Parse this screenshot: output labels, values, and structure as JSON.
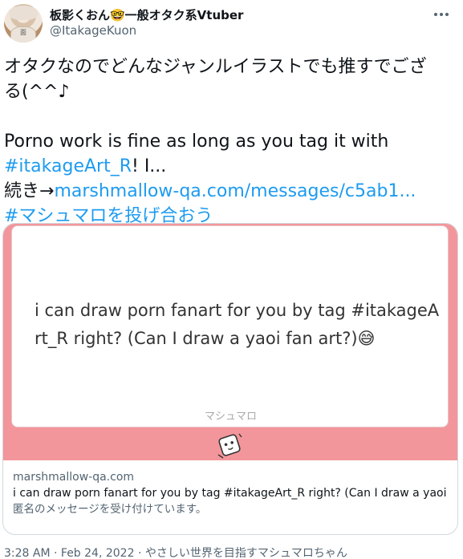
{
  "author": {
    "display_name": "板影くおん🤓一般オタク系Vtuber",
    "handle": "@ItakageKuon",
    "avatar_mark": "面"
  },
  "more_icon": "ellipsis-icon",
  "tweet": {
    "line1": "オタクなのでどんなジャンルイラストでも推すでござ",
    "line2": "る(^^♪",
    "line3": "Porno work is fine as long as you tag it with",
    "hashtag1": "#itakageArt_R",
    "line4_rest": "! I...",
    "continue_label": "続き→",
    "continue_link": "marshmallow-qa.com/messages/c5ab1...",
    "hashtag2": "#マシュマロを投げ合おう"
  },
  "card": {
    "question_line1": "i can draw porn fanart for you by tag #itakageA",
    "question_line2": "rt_R right? (Can I draw a yaoi fan art?)😅",
    "brand": "マシュマロ",
    "mascot_icon": "marshmallow-mascot-icon",
    "domain": "marshmallow-qa.com",
    "title": "i can draw porn fanart for you by tag #itakageArt_R right? (Can I draw a yaoi fa...",
    "description": "匿名のメッセージを受け付けています。",
    "image_bg_color": "#f3969b"
  },
  "footer": {
    "time": "3:28 AM",
    "separator1": " · ",
    "date": "Feb 24, 2022",
    "separator2": " · ",
    "source": "やさしい世界を目指すマシュマロちゃん"
  }
}
